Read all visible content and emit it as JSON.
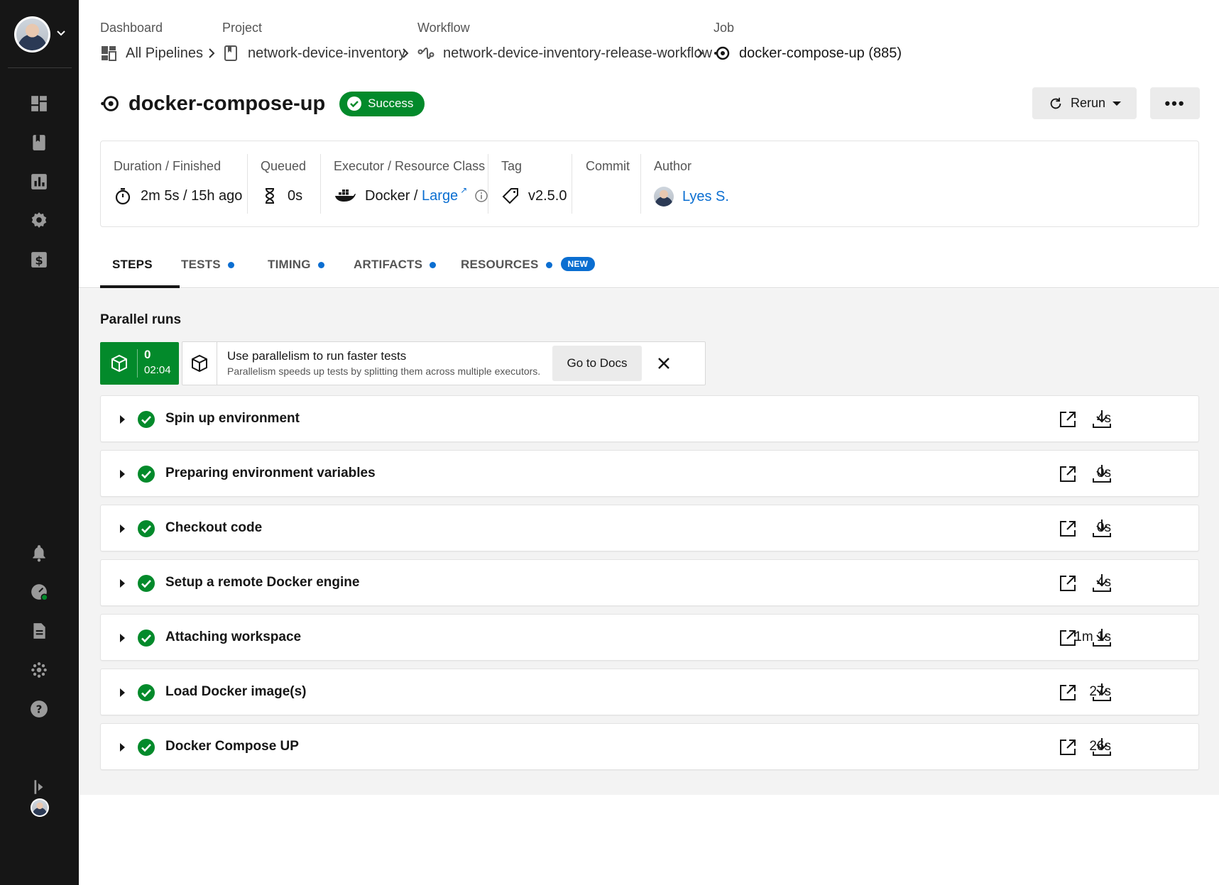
{
  "breadcrumbs": {
    "dashboard": {
      "label": "Dashboard",
      "value": "All Pipelines"
    },
    "project": {
      "label": "Project",
      "value": "network-device-inventory"
    },
    "workflow": {
      "label": "Workflow",
      "value": "network-device-inventory-release-workflow"
    },
    "job": {
      "label": "Job",
      "value": "docker-compose-up (885)"
    }
  },
  "header": {
    "title": "docker-compose-up",
    "status": "Success",
    "rerun_label": "Rerun",
    "more_label": "•••"
  },
  "meta": {
    "duration": {
      "label": "Duration / Finished",
      "value": "2m 5s / 15h ago"
    },
    "queued": {
      "label": "Queued",
      "value": "0s"
    },
    "executor": {
      "label": "Executor / Resource Class",
      "executor": "Docker",
      "separator": " / ",
      "resource_class": "Large"
    },
    "tag": {
      "label": "Tag",
      "value": "v2.5.0"
    },
    "commit": {
      "label": "Commit"
    },
    "author": {
      "label": "Author",
      "value": "Lyes S."
    }
  },
  "tabs": {
    "steps": "STEPS",
    "tests": "TESTS",
    "timing": "TIMING",
    "artifacts": "ARTIFACTS",
    "resources": "RESOURCES",
    "new_badge": "NEW"
  },
  "parallel": {
    "title": "Parallel runs",
    "run_index": "0",
    "run_time": "02:04",
    "promo_title": "Use parallelism to run faster tests",
    "promo_desc": "Parallelism speeds up tests by splitting them across multiple executors.",
    "docs_button": "Go to Docs"
  },
  "steps": [
    {
      "name": "Spin up environment",
      "duration": "4s"
    },
    {
      "name": "Preparing environment variables",
      "duration": "0s"
    },
    {
      "name": "Checkout code",
      "duration": "0s"
    },
    {
      "name": "Setup a remote Docker engine",
      "duration": "4s"
    },
    {
      "name": "Attaching workspace",
      "duration": "1m 1s"
    },
    {
      "name": "Load Docker image(s)",
      "duration": "27s"
    },
    {
      "name": "Docker Compose UP",
      "duration": "26s"
    }
  ],
  "colors": {
    "success": "#038a2b",
    "link": "#0a6ed1",
    "sidebar": "#161616"
  }
}
